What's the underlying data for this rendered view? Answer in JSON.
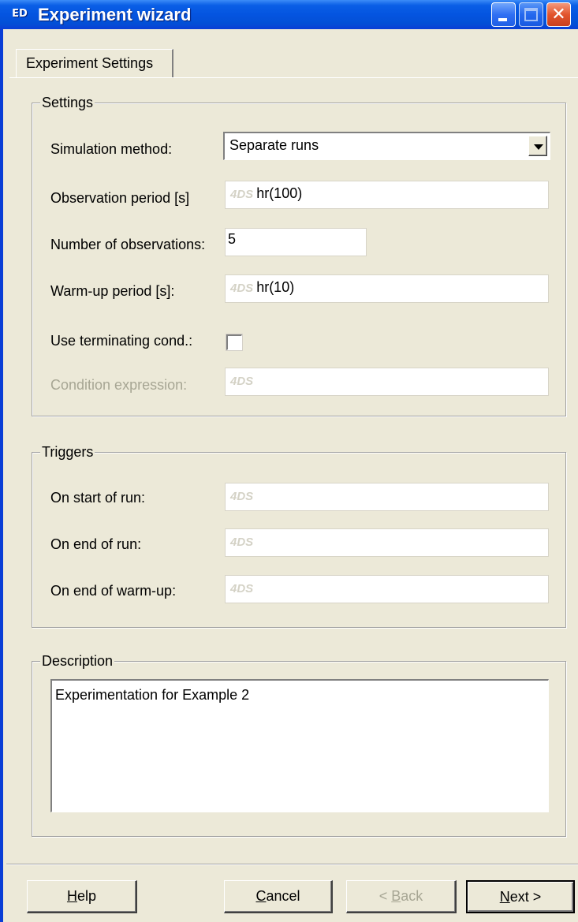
{
  "window": {
    "app_icon_text": "ED",
    "title": "Experiment wizard"
  },
  "tabs": [
    {
      "label": "Experiment Settings",
      "active": true
    }
  ],
  "settings": {
    "group_title": "Settings",
    "simulation_method": {
      "label": "Simulation method:",
      "value": "Separate runs"
    },
    "observation_period": {
      "label": "Observation period [s]",
      "prefix": "4DS",
      "value": "hr(100)"
    },
    "number_of_observations": {
      "label": "Number of observations:",
      "value": "5"
    },
    "warmup_period": {
      "label": "Warm-up period [s]:",
      "prefix": "4DS",
      "value": "hr(10)"
    },
    "use_terminating_cond": {
      "label": "Use terminating cond.:",
      "checked": false
    },
    "condition_expression": {
      "label": "Condition expression:",
      "prefix": "4DS",
      "value": "",
      "disabled": true
    }
  },
  "triggers": {
    "group_title": "Triggers",
    "on_start_of_run": {
      "label": "On start of run:",
      "prefix": "4DS",
      "value": ""
    },
    "on_end_of_run": {
      "label": "On end of run:",
      "prefix": "4DS",
      "value": ""
    },
    "on_end_of_warmup": {
      "label": "On end of warm-up:",
      "prefix": "4DS",
      "value": ""
    }
  },
  "description": {
    "group_title": "Description",
    "text": "Experimentation for Example 2"
  },
  "buttons": {
    "help": {
      "label": "Help",
      "mnemonic": "H",
      "rest": "elp"
    },
    "cancel": {
      "label": "Cancel",
      "mnemonic": "C",
      "rest": "ancel"
    },
    "back": {
      "label": "< Back",
      "pre": "< ",
      "mnemonic": "B",
      "rest": "ack",
      "disabled": true
    },
    "next": {
      "label": "Next >",
      "mnemonic": "N",
      "rest": "ext >"
    }
  },
  "colors": {
    "titlebar": "#0454e0",
    "face": "#ece9d8",
    "disabled_text": "#a7a694"
  }
}
